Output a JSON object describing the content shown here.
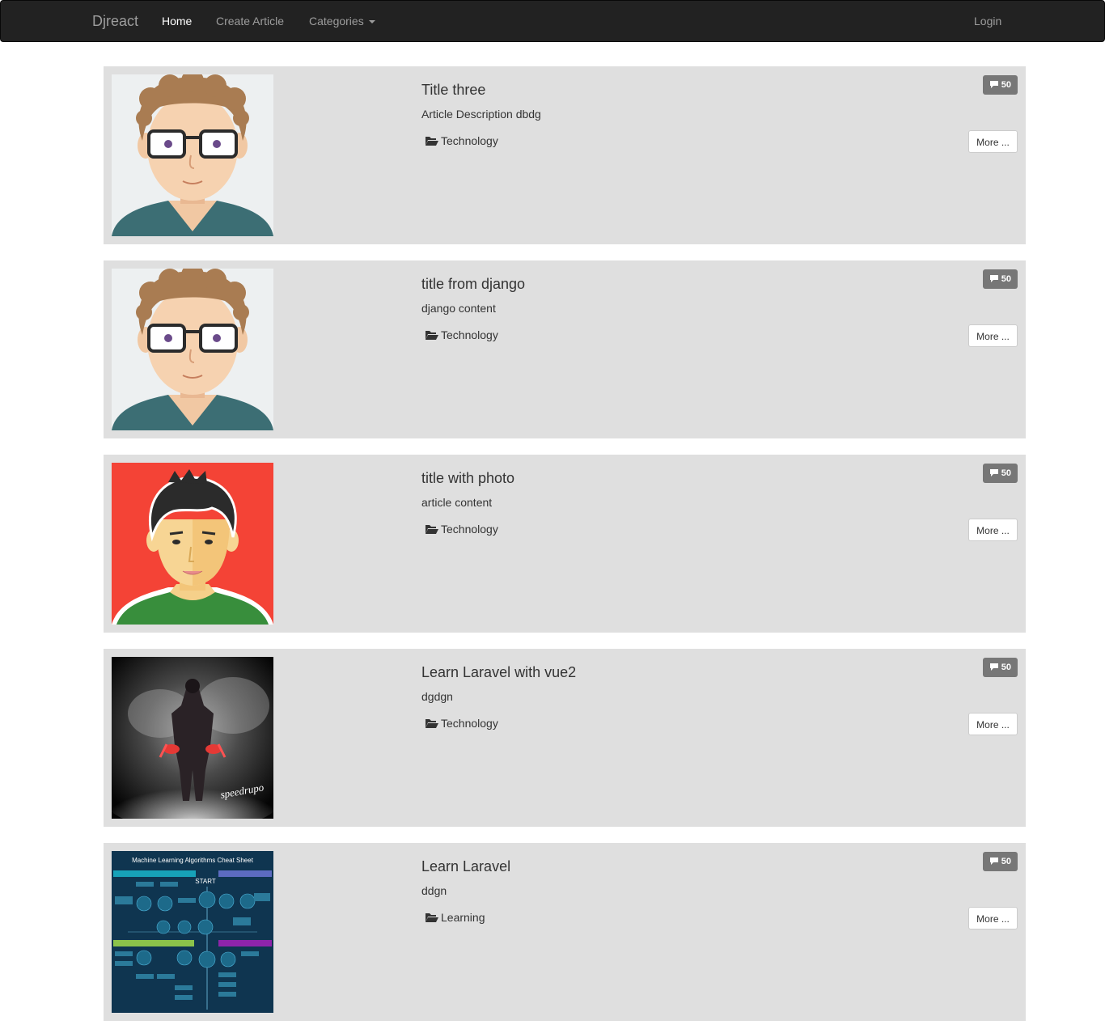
{
  "navbar": {
    "brand": "Djreact",
    "items": [
      {
        "label": "Home"
      },
      {
        "label": "Create Article"
      },
      {
        "label": "Categories"
      }
    ],
    "login": "Login"
  },
  "articles": [
    {
      "title": "Title three",
      "description": "Article Description dbdg",
      "category": "Technology",
      "comments": "50",
      "more": "More ..."
    },
    {
      "title": "title from django",
      "description": "django content",
      "category": "Technology",
      "comments": "50",
      "more": "More ..."
    },
    {
      "title": "title with photo",
      "description": "article content",
      "category": "Technology",
      "comments": "50",
      "more": "More ..."
    },
    {
      "title": "Learn Laravel with vue2",
      "description": "dgdgn",
      "category": "Technology",
      "comments": "50",
      "more": "More ..."
    },
    {
      "title": "Learn Laravel",
      "description": "ddgn",
      "category": "Learning",
      "comments": "50",
      "more": "More ..."
    }
  ],
  "thumbnail_text": {
    "warrior_signature": "speedrupo",
    "cheatsheet_title": "Machine Learning Algorithms Cheat Sheet",
    "cheatsheet_start": "START"
  },
  "colors": {
    "navbar_bg": "#222222",
    "card_bg": "#dfdfdf",
    "badge_bg": "#777777"
  }
}
